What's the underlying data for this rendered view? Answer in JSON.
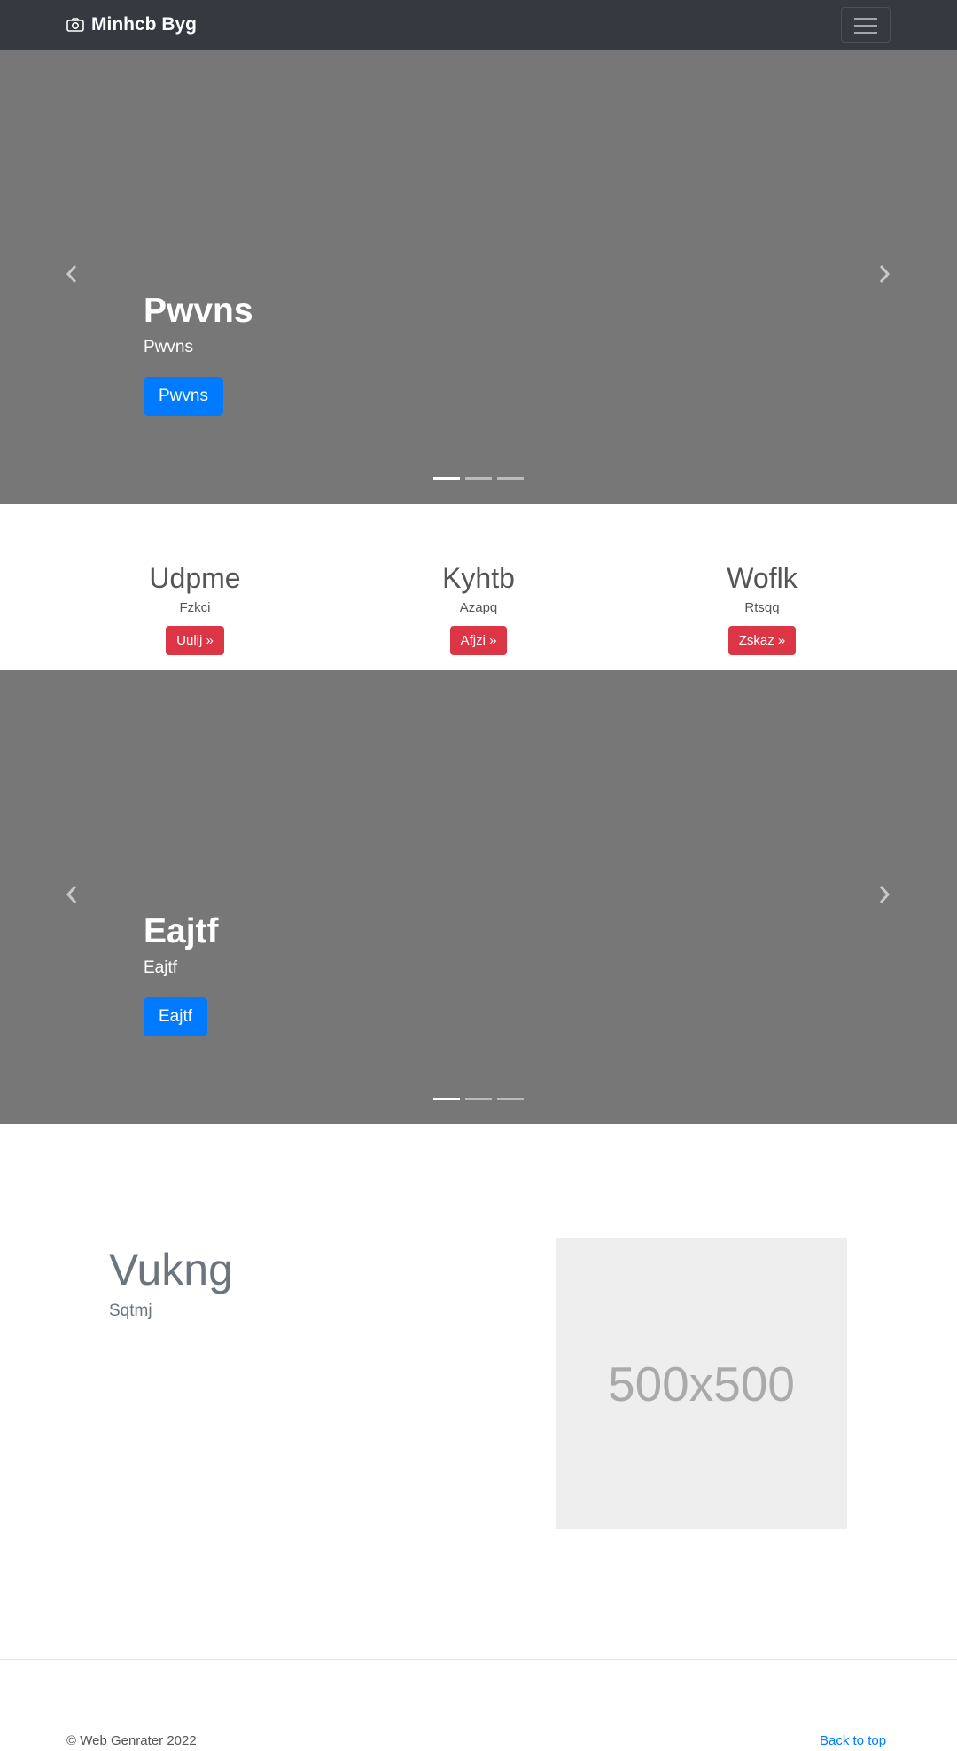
{
  "navbar": {
    "brand": "Minhcb Byg",
    "brand_icon": "camera-icon",
    "toggler_icon": "hamburger-icon"
  },
  "carousel1": {
    "heading": "Pwvns",
    "text": "Pwvns",
    "button": "Pwvns",
    "indicators": 3,
    "active_indicator": 0
  },
  "features": [
    {
      "heading": "Udpme",
      "text": "Fzkci",
      "button": "Uulij »"
    },
    {
      "heading": "Kyhtb",
      "text": "Azapq",
      "button": "Afjzi »"
    },
    {
      "heading": "Woflk",
      "text": "Rtsqq",
      "button": "Zskaz »"
    }
  ],
  "carousel2": {
    "heading": "Eajtf",
    "text": "Eajtf",
    "button": "Eajtf",
    "indicators": 3,
    "active_indicator": 0
  },
  "featurette": {
    "heading": "Vukng",
    "text": "Sqtmj",
    "image_label": "500x500"
  },
  "footer": {
    "copyright": "© Web Genrater 2022",
    "back_to_top": "Back to top"
  },
  "colors": {
    "navbar": "#343a40",
    "carousel_bg": "#777777",
    "primary": "#007bff",
    "danger": "#dc3545",
    "placeholder_bg": "#eeeeee"
  }
}
